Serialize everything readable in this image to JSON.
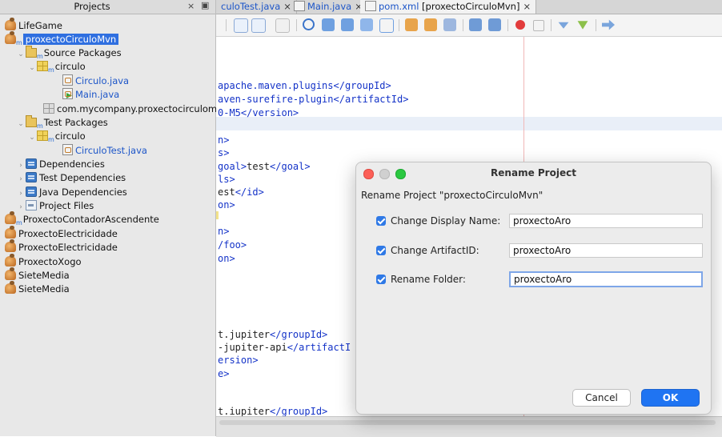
{
  "projects_panel": {
    "title": "Projects",
    "close_glyph": "×",
    "max_glyph": "▣",
    "items": [
      {
        "label": "LifeGame",
        "icon": "project-icon"
      },
      {
        "label": "proxectoCirculoMvn",
        "icon": "project-icon",
        "selected": true
      },
      {
        "label": "Source Packages",
        "icon": "package-folder-icon"
      },
      {
        "label": "circulo",
        "icon": "package-icon"
      },
      {
        "label": "Circulo.java",
        "icon": "java-file-icon"
      },
      {
        "label": "Main.java",
        "icon": "java-main-file-icon"
      },
      {
        "label": "com.mycompany.proxectocirculomvn",
        "icon": "empty-package-icon"
      },
      {
        "label": "Test Packages",
        "icon": "package-folder-icon"
      },
      {
        "label": "circulo",
        "icon": "package-icon"
      },
      {
        "label": "CirculoTest.java",
        "icon": "java-file-icon"
      },
      {
        "label": "Dependencies",
        "icon": "library-icon"
      },
      {
        "label": "Test Dependencies",
        "icon": "library-icon"
      },
      {
        "label": "Java Dependencies",
        "icon": "library-icon"
      },
      {
        "label": "Project Files",
        "icon": "project-files-icon"
      },
      {
        "label": "ProxectoContadorAscendente",
        "icon": "project-icon"
      },
      {
        "label": "ProxectoElectricidade",
        "icon": "project-icon"
      },
      {
        "label": "ProxectoElectricidade",
        "icon": "project-icon"
      },
      {
        "label": "ProxectoXogo",
        "icon": "project-icon"
      },
      {
        "label": "SieteMedia",
        "icon": "project-icon"
      },
      {
        "label": "SieteMedia",
        "icon": "project-icon"
      }
    ],
    "maven_sub": "m"
  },
  "editor": {
    "tabs": [
      {
        "label": "culoTest.java",
        "close": "×"
      },
      {
        "label": "Main.java",
        "close": "×"
      },
      {
        "label": "pom.xml",
        "suffix": " [proxectoCirculoMvn]",
        "close": "×"
      }
    ],
    "code_lines": [
      {
        "tag": "apache.maven.plugins</groupId>",
        "text": ""
      },
      {
        "tag": "aven-surefire-plugin</artifactId>",
        "text": ""
      },
      {
        "tag": "0-M5</version>",
        "text": ""
      },
      {
        "tag": "n>",
        "text": ""
      },
      {
        "tag": "s>",
        "text": ""
      },
      {
        "tag": "goal>",
        "text": "test",
        "tag2": "</goal>"
      },
      {
        "tag": "ls>",
        "text": ""
      },
      {
        "tag": "",
        "text": "est",
        "tag2": "</id>"
      },
      {
        "tag": "on>",
        "text": ""
      },
      {
        "tag": "n>",
        "text": ""
      },
      {
        "tag": "/foo>",
        "text": ""
      },
      {
        "tag": "on>",
        "text": ""
      },
      {
        "tag": "",
        "text": "t.jupiter",
        "tag2": "</groupId>"
      },
      {
        "tag": "",
        "text": "-jupiter-api",
        "tag2": "</artifactI"
      },
      {
        "tag": "ersion>",
        "text": ""
      },
      {
        "tag": "e>",
        "text": ""
      },
      {
        "tag": "",
        "text": "t.iupiter",
        "tag2": "</groupId>"
      }
    ]
  },
  "dialog": {
    "title": "Rename Project",
    "heading": "Rename Project \"proxectoCirculoMvn\"",
    "options": [
      {
        "label": "Change Display Name:",
        "value": "proxectoAro",
        "checked": true
      },
      {
        "label": "Change ArtifactID:",
        "value": "proxectoAro",
        "checked": true
      },
      {
        "label": "Rename Folder:",
        "value": "proxectoAro",
        "checked": true
      }
    ],
    "cancel_label": "Cancel",
    "ok_label": "OK"
  },
  "colors": {
    "selection": "#2f6fe0",
    "ok_button": "#1f74f2",
    "checkbox": "#2f79e6",
    "xml_tag": "#1433c8"
  }
}
